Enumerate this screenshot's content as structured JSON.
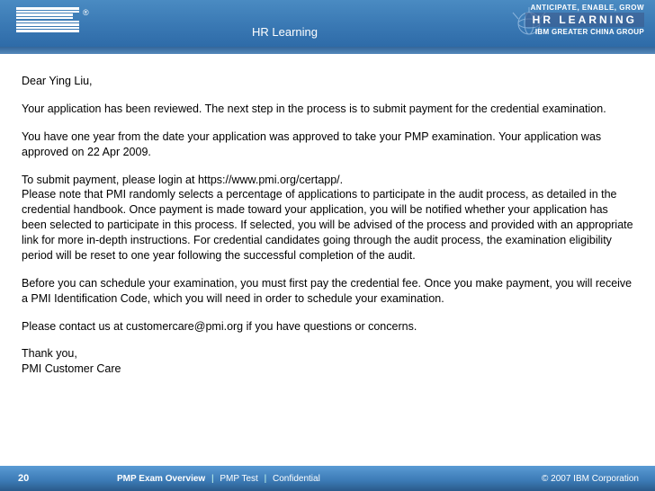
{
  "header": {
    "logo_name": "IBM",
    "registered": "®",
    "section_label": "HR Learning",
    "tagline": "ANTICIPATE, ENABLE, GROW",
    "hr_big": "HR LEARNING",
    "region": "IBM GREATER CHINA GROUP"
  },
  "letter": {
    "greeting": "Dear Ying Liu,",
    "p1": "Your application has been reviewed. The next step in the process is to submit payment for the credential examination.",
    "p2": "You have one year from the date your application was approved to take your PMP examination. Your application was approved on 22 Apr 2009.",
    "p3a": "To submit payment, please login at https://www.pmi.org/certapp/.",
    "p3b": "Please note that PMI randomly selects a percentage of applications to participate in the audit process, as detailed in the credential handbook. Once payment is made toward your application, you will be notified whether your application has been selected to participate in this process. If selected, you will be advised of the process and provided with an appropriate link for more in-depth instructions. For credential candidates going through the audit process, the examination eligibility period will be reset to one year following the successful completion of the audit.",
    "p4": "Before you can schedule your examination, you must first pay the credential fee. Once you make payment, you will receive a PMI Identification Code, which you will need in order to schedule your examination.",
    "p5": "Please contact us at customercare@pmi.org if you have questions or concerns.",
    "thanks": "Thank you,",
    "signature": "PMI Customer Care"
  },
  "footer": {
    "page": "20",
    "title": "PMP Exam Overview",
    "sep": "|",
    "sub1": "PMP Test",
    "sub2": "Confidential",
    "copyright": "© 2007 IBM Corporation"
  }
}
